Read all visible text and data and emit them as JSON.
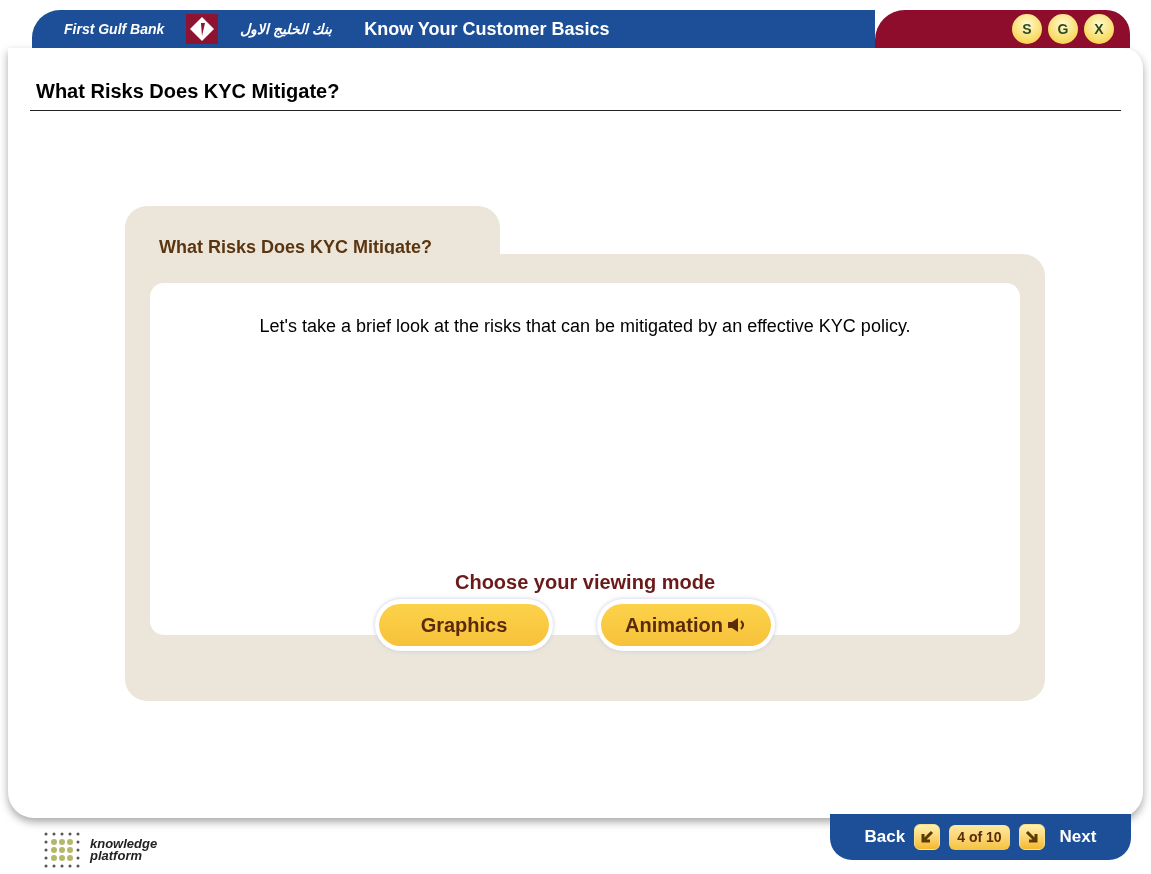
{
  "header": {
    "brand": "First Gulf Bank",
    "brand_arabic": "بنك الخليج الاول",
    "course_title": "Know Your Customer Basics",
    "buttons": [
      "S",
      "G",
      "X"
    ]
  },
  "page_title": "What Risks Does KYC Mitigate?",
  "panel": {
    "tab_title": "What Risks Does KYC Mitigate?",
    "intro": "Let's take a brief look at the risks that can be mitigated by an effective KYC policy.",
    "prompt": "Choose your viewing mode",
    "modes": [
      {
        "label": "Graphics",
        "kind": "plain"
      },
      {
        "label": "Animation",
        "kind": "audio"
      }
    ]
  },
  "footer": {
    "logo_line1": "knowledge",
    "logo_line2": "platform",
    "back": "Back",
    "page_indicator": "4 of 10",
    "next": "Next"
  }
}
